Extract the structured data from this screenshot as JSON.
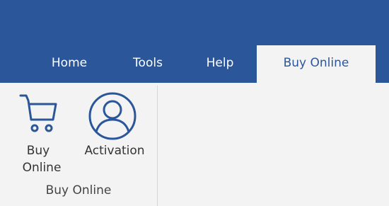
{
  "tabs": [
    {
      "label": "Home"
    },
    {
      "label": "Tools"
    },
    {
      "label": "Help"
    },
    {
      "label": "Buy Online",
      "active": true
    }
  ],
  "ribbon": {
    "group_label": "Buy Online",
    "buttons": [
      {
        "label_line1": "Buy",
        "label_line2": "Online",
        "icon": "shopping-cart-icon"
      },
      {
        "label_line1": "Activation",
        "icon": "user-circle-icon"
      }
    ]
  },
  "colors": {
    "accent": "#2b579a",
    "ribbon_bg": "#f3f3f3",
    "icon_color": "#2b579a"
  }
}
